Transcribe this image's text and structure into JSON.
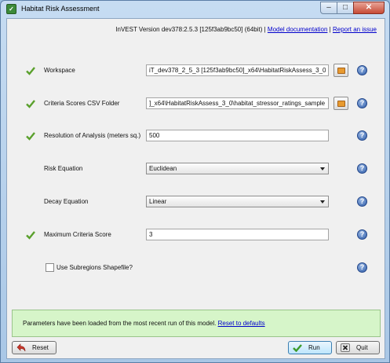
{
  "window": {
    "title": "Habitat Risk Assessment",
    "icon_name": "app-leaf-icon",
    "controls": [
      "minimize",
      "maximize",
      "close"
    ]
  },
  "header": {
    "version_text": "InVEST Version dev378:2.5.3 [125f3ab9bc50] (64bit)",
    "separator": "|",
    "doc_link": "Model documentation",
    "issue_link": "Report an issue"
  },
  "form": {
    "workspace": {
      "label": "Workspace",
      "value": "iT_dev378_2_5_3 [125f3ab9bc50]_x64\\HabitatRiskAssess_3_0",
      "valid": true
    },
    "criteria_csv": {
      "label": "Criteria Scores CSV Folder",
      "value": "]_x64\\HabitatRiskAssess_3_0\\habitat_stressor_ratings_sample",
      "valid": true
    },
    "resolution": {
      "label": "Resolution of Analysis (meters sq.)",
      "value": "500",
      "valid": true
    },
    "risk_equation": {
      "label": "Risk Equation",
      "selected": "Euclidean"
    },
    "decay_equation": {
      "label": "Decay Equation",
      "selected": "Linear"
    },
    "max_criteria": {
      "label": "Maximum Criteria Score",
      "value": "3",
      "valid": true
    },
    "subregions": {
      "label": "Use Subregions Shapefile?",
      "checked": false
    }
  },
  "status": {
    "message": "Parameters have been loaded from the most recent run of this model.",
    "link": "Reset to defaults"
  },
  "buttons": {
    "reset": "Reset",
    "run": "Run",
    "quit": "Quit"
  },
  "colors": {
    "valid_check": "#5aa02c",
    "status_bg": "#d6f5c9",
    "link": "#0000cc"
  }
}
